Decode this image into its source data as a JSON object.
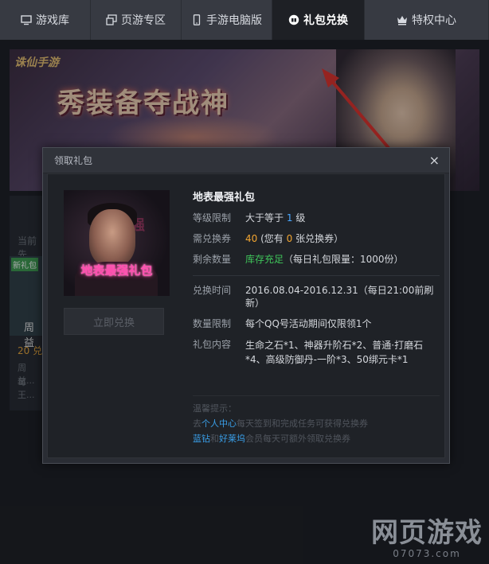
{
  "tabs": [
    {
      "label": "游戏库",
      "icon": "monitor-icon"
    },
    {
      "label": "页游专区",
      "icon": "window-icon"
    },
    {
      "label": "手游电脑版",
      "icon": "phone-icon"
    },
    {
      "label": "礼包兑换",
      "icon": "gift-badge-icon",
      "active": true
    },
    {
      "label": "特权中心",
      "icon": "crown-icon"
    }
  ],
  "banner": {
    "logo_text": "诛仙手游",
    "slogan": "秀装备夺战神"
  },
  "background_list": {
    "section_label": "当前先",
    "badge": "新礼包",
    "item_name": "周益",
    "points": "20 兑",
    "desc1": "周益...",
    "desc2": "每王..."
  },
  "modal": {
    "title": "领取礼包",
    "close": "×",
    "cover_text": "地表最强礼包",
    "cover_bg_text": "最强",
    "claim_label": "立即兑换",
    "gift_name": "地表最强礼包",
    "level_key": "等级限制",
    "level_pre": "大于等于",
    "level_num": "1",
    "level_suf": "级",
    "cost_key": "需兑换券",
    "cost_num": "40",
    "cost_mid": "(您有",
    "cost_have": "0",
    "cost_suf": "张兑换券）",
    "stock_key": "剩余数量",
    "stock_status": "库存充足",
    "stock_limit": "（每日礼包限量：1000份）",
    "time_key": "兑换时间",
    "time_val": "2016.08.04-2016.12.31（每日21:00前刷新）",
    "qty_key": "数量限制",
    "qty_val": "每个QQ号活动期间仅限领1个",
    "content_key": "礼包内容",
    "content_val": "生命之石*1、神器升阶石*2、普通·打磨石*4、高级防御丹-一阶*3、50绑元卡*1",
    "tips_title": "温馨提示：",
    "tip1_pre": "去",
    "tip1_link": "个人中心",
    "tip1_suf": "每天签到和完成任务可获得兑换券",
    "tip2_link1": "蓝钻",
    "tip2_mid": "和",
    "tip2_link2": "好莱坞",
    "tip2_suf": "会员每天可额外领取兑换券"
  },
  "watermark": {
    "big": "网页游戏",
    "small": "07073.com"
  }
}
